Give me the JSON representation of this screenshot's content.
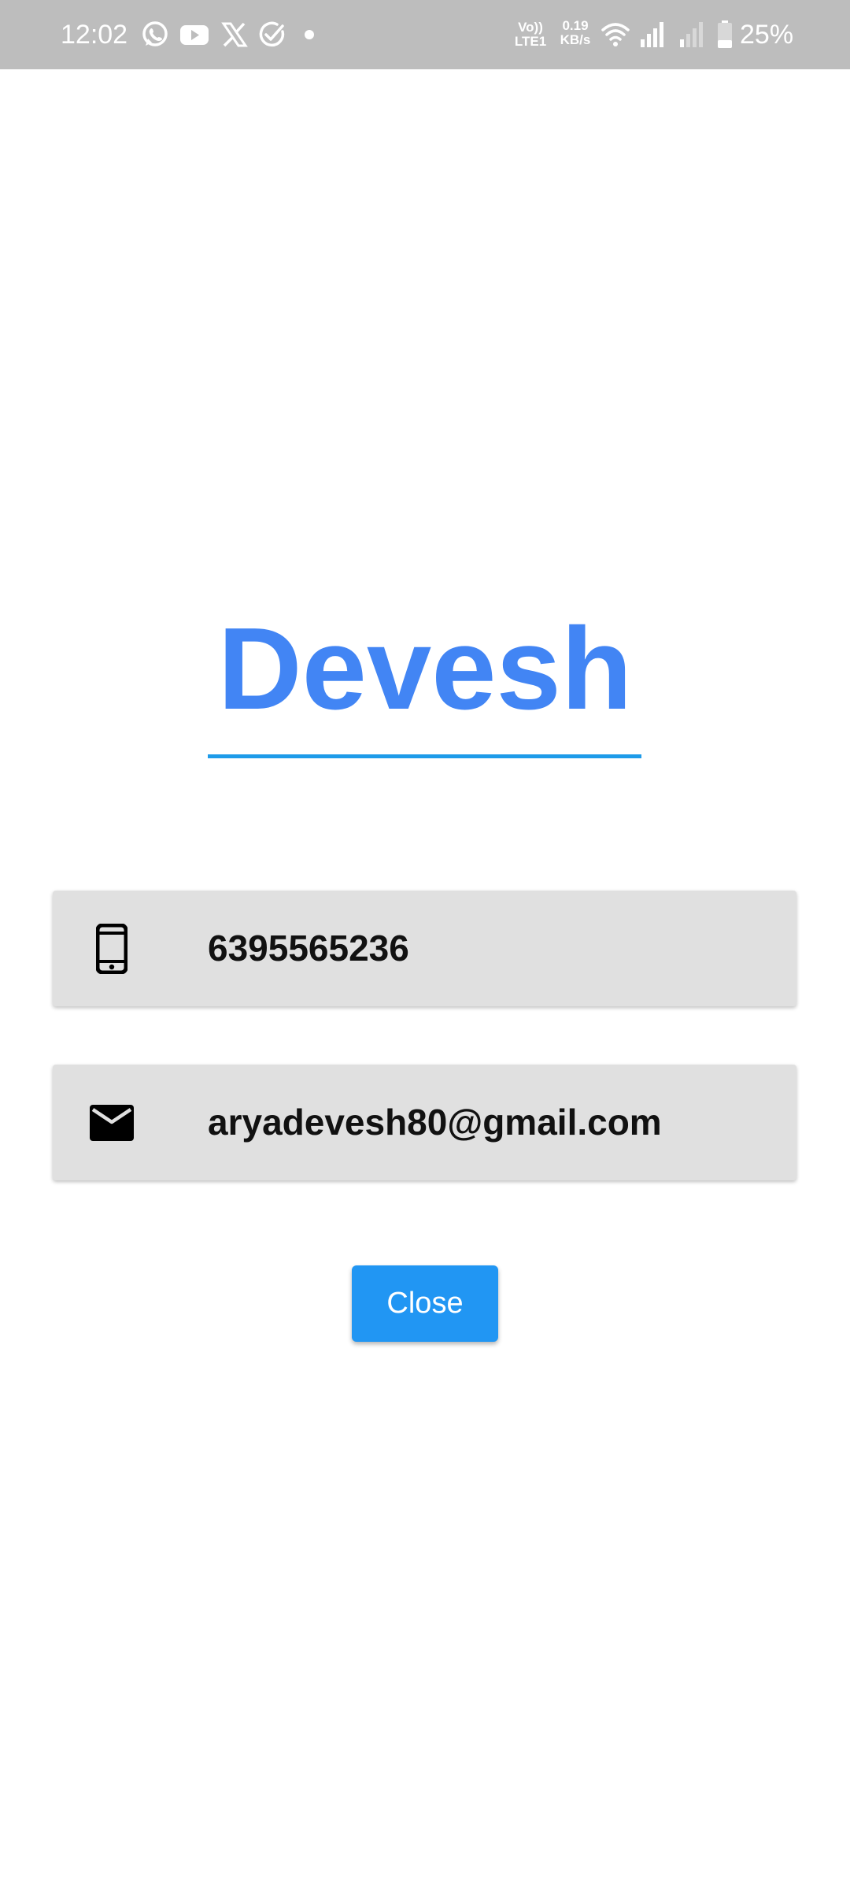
{
  "status_bar": {
    "time": "12:02",
    "notification_icons": [
      "whatsapp-icon",
      "youtube-icon",
      "x-icon",
      "check-circle-icon",
      "dot-icon"
    ],
    "volte_top": "Vo))",
    "volte_bottom": "LTE1",
    "speed_value": "0.19",
    "speed_unit": "KB/s",
    "battery_percent": "25%"
  },
  "contact": {
    "name": "Devesh",
    "phone": "6395565236",
    "email": "aryadevesh80@gmail.com"
  },
  "actions": {
    "close_label": "Close"
  },
  "colors": {
    "status_bar_bg": "#bdbdbd",
    "name_color": "#4285f4",
    "underline_color": "#1e9be9",
    "card_bg": "#e0e0e0",
    "button_bg": "#2196f3"
  }
}
